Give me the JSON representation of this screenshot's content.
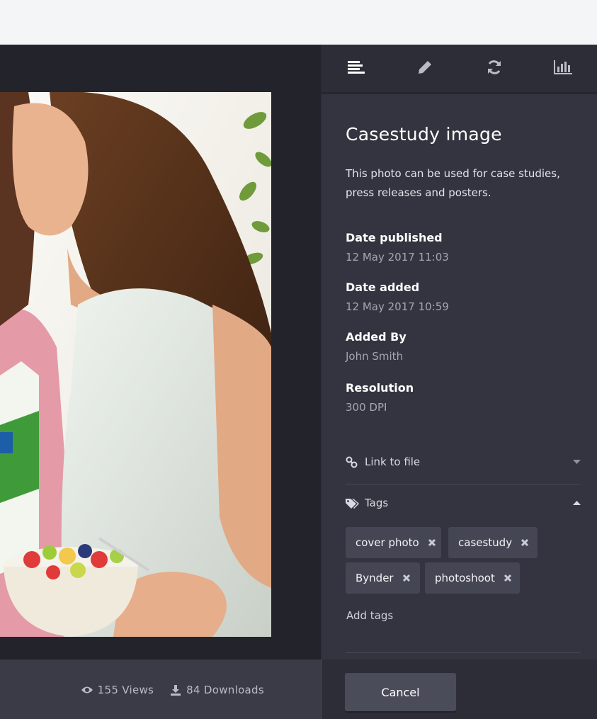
{
  "tabs": [
    {
      "icon": "info-lines-icon",
      "active": true
    },
    {
      "icon": "pencil-icon",
      "active": false
    },
    {
      "icon": "refresh-icon",
      "active": false
    },
    {
      "icon": "bar-chart-icon",
      "active": false
    }
  ],
  "asset": {
    "title": "Casestudy image",
    "description": "This photo can be used for case studies, press releases and posters."
  },
  "fields": {
    "date_published": {
      "label": "Date published",
      "value": "12 May  2017 11:03"
    },
    "date_added": {
      "label": "Date added",
      "value": "12 May  2017 10:59"
    },
    "added_by": {
      "label": "Added By",
      "value": "John Smith"
    },
    "resolution": {
      "label": "Resolution",
      "value": "300 DPI"
    }
  },
  "link_section": {
    "label": "Link to file",
    "icon": "link-icon",
    "state": "collapsed"
  },
  "tags_section": {
    "label": "Tags",
    "icon": "tags-icon",
    "state": "expanded"
  },
  "tags": [
    "cover photo",
    "casestudy",
    "Bynder",
    "photoshoot"
  ],
  "add_tags_label": "Add tags",
  "stats": {
    "views": "155 Views",
    "downloads": "84 Downloads"
  },
  "footer": {
    "cancel_label": "Cancel"
  },
  "colors": {
    "panel_bg": "#33343f",
    "viewer_bg": "#23242b",
    "tag_bg": "#454653",
    "text_muted": "#a3a5b0"
  }
}
